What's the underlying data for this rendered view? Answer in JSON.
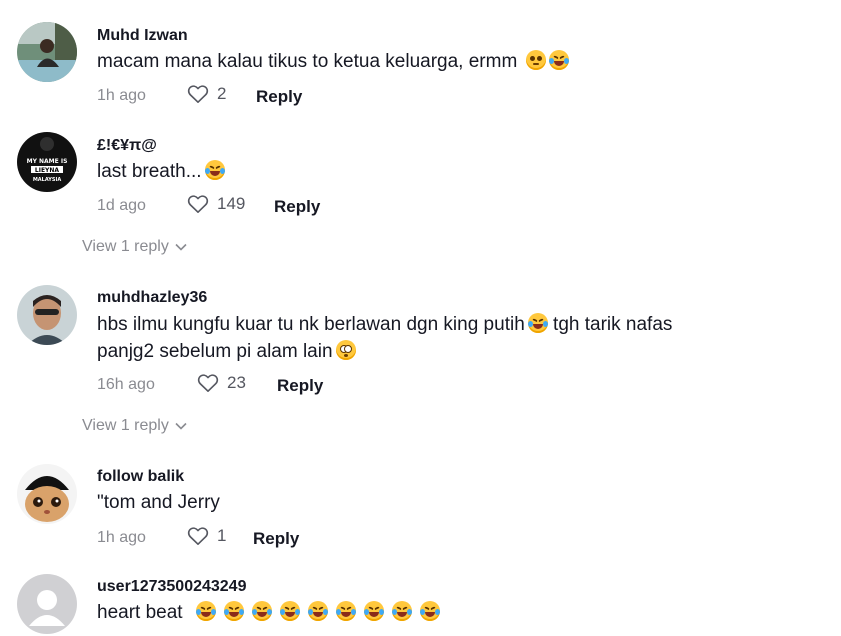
{
  "comments": [
    {
      "username": "Muhd Izwan",
      "text": "macam mana kalau tikus to ketua keluarga, ermm",
      "emojis": [
        "crying-face-emoji",
        "squinting-face-emoji"
      ],
      "time": "1h ago",
      "likes": "2",
      "reply_label": "Reply"
    },
    {
      "username": "£!€¥π@",
      "text": "last breath...",
      "emojis": [
        "tears-of-joy-emoji"
      ],
      "time": "1d ago",
      "likes": "149",
      "reply_label": "Reply",
      "view_replies": "View 1 reply",
      "avatar_text": [
        "MY NAME IS",
        "LIEYNA",
        "MALAYSIA"
      ]
    },
    {
      "username": "muhdhazley36",
      "text_line1": "hbs ilmu kungfu kuar tu nk berlawan dgn king putih",
      "text_line1b": "tgh tarik nafas",
      "text_line2": "panjg2 sebelum pi alam lain",
      "emojis": [
        "tears-of-joy-emoji",
        "flushed-face-emoji"
      ],
      "time": "16h ago",
      "likes": "23",
      "reply_label": "Reply",
      "view_replies": "View 1 reply"
    },
    {
      "username": "follow balik",
      "text": "\"tom and Jerry",
      "time": "1h ago",
      "likes": "1",
      "reply_label": "Reply"
    },
    {
      "username": "user1273500243249",
      "text": "heart beat",
      "emojis": [
        "tears-of-joy-emoji",
        "tears-of-joy-emoji",
        "tears-of-joy-emoji",
        "tears-of-joy-emoji",
        "tears-of-joy-emoji",
        "tears-of-joy-emoji",
        "tears-of-joy-emoji",
        "tears-of-joy-emoji",
        "tears-of-joy-emoji"
      ]
    }
  ],
  "icons": {
    "like": "heart-outline-icon",
    "expand": "chevron-down-icon",
    "default_avatar": "default-user-avatar-icon"
  },
  "colors": {
    "text": "#161823",
    "muted": "#8a8b91",
    "emoji": "#ffc83d"
  }
}
